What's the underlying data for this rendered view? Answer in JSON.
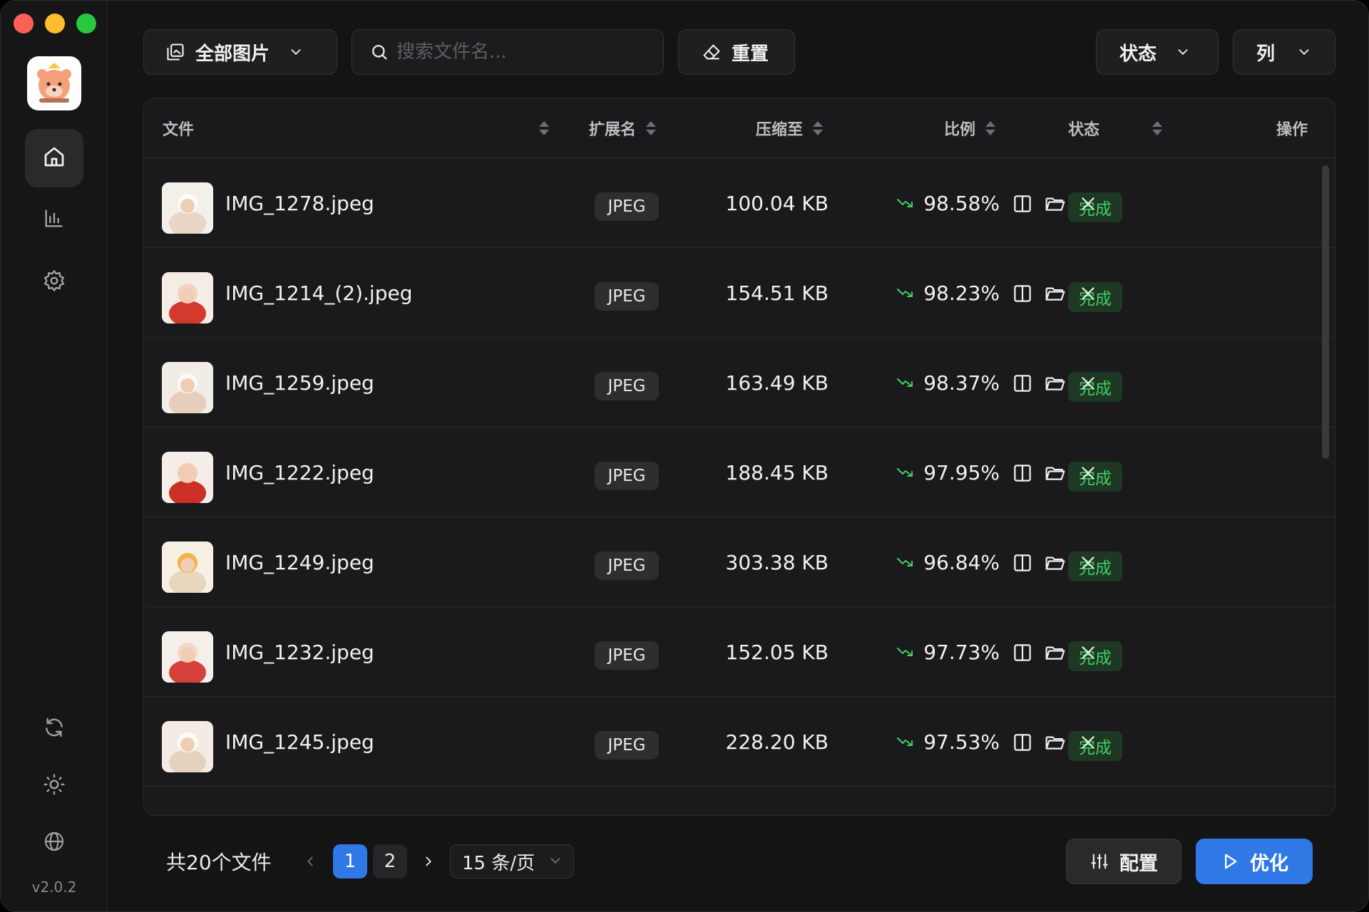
{
  "app": {
    "version": "v2.0.2"
  },
  "toolbar": {
    "filter_label": "全部图片",
    "search_placeholder": "搜索文件名...",
    "reset_label": "重置",
    "status_label": "状态",
    "columns_label": "列"
  },
  "table": {
    "headers": {
      "file": "文件",
      "ext": "扩展名",
      "compressed": "压缩至",
      "ratio": "比例",
      "status": "状态",
      "actions": "操作"
    },
    "rows": [
      {
        "name": "IMG_1278.jpeg",
        "ext": "JPEG",
        "size": "100.04 KB",
        "ratio": "98.58%",
        "status": "完成"
      },
      {
        "name": "IMG_1214_(2).jpeg",
        "ext": "JPEG",
        "size": "154.51 KB",
        "ratio": "98.23%",
        "status": "完成"
      },
      {
        "name": "IMG_1259.jpeg",
        "ext": "JPEG",
        "size": "163.49 KB",
        "ratio": "98.37%",
        "status": "完成"
      },
      {
        "name": "IMG_1222.jpeg",
        "ext": "JPEG",
        "size": "188.45 KB",
        "ratio": "97.95%",
        "status": "完成"
      },
      {
        "name": "IMG_1249.jpeg",
        "ext": "JPEG",
        "size": "303.38 KB",
        "ratio": "96.84%",
        "status": "完成"
      },
      {
        "name": "IMG_1232.jpeg",
        "ext": "JPEG",
        "size": "152.05 KB",
        "ratio": "97.73%",
        "status": "完成"
      },
      {
        "name": "IMG_1245.jpeg",
        "ext": "JPEG",
        "size": "228.20 KB",
        "ratio": "97.53%",
        "status": "完成"
      }
    ]
  },
  "footer": {
    "total": "共20个文件",
    "pages": [
      "1",
      "2"
    ],
    "current_page": "1",
    "per_page": "15 条/页",
    "config_label": "配置",
    "optimize_label": "优化"
  },
  "colors": {
    "accent": "#2f78e6",
    "success": "#3fcf63",
    "ratio_arrow": "#3fcf63"
  },
  "icons": {
    "sidebar_top": [
      "home-icon",
      "chart-icon",
      "gear-icon"
    ],
    "sidebar_bottom": [
      "refresh-icon",
      "sun-icon",
      "globe-icon"
    ],
    "row_actions": [
      "compare-icon",
      "folder-icon",
      "close-icon"
    ]
  }
}
